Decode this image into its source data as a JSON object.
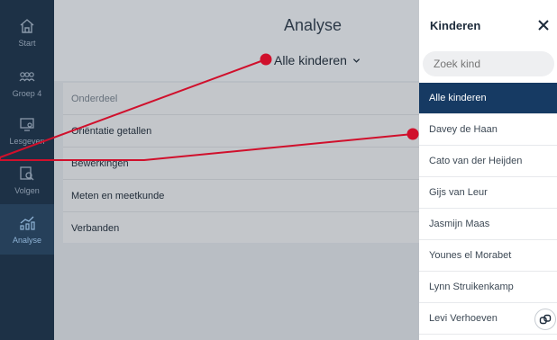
{
  "nav": {
    "items": [
      {
        "label": "Start",
        "icon": "home-icon"
      },
      {
        "label": "Groep 4",
        "icon": "group-icon"
      },
      {
        "label": "Lesgeven",
        "icon": "teach-icon"
      },
      {
        "label": "Volgen",
        "icon": "follow-icon"
      },
      {
        "label": "Analyse",
        "icon": "chart-icon",
        "active": true
      }
    ]
  },
  "header": {
    "title": "Analyse",
    "filter_label": "Alle kinderen"
  },
  "table": {
    "column_header": "Onderdeel",
    "rows": [
      "Oriëntatie getallen",
      "Bewerkingen",
      "Meten en meetkunde",
      "Verbanden"
    ]
  },
  "drawer": {
    "title": "Kinderen",
    "search_placeholder": "Zoek kind",
    "items": [
      "Alle kinderen",
      "Davey de Haan",
      "Cato van der Heijden",
      "Gijs van Leur",
      "Jasmijn Maas",
      "Younes el Morabet",
      "Lynn Struikenkamp",
      "Levi Verhoeven"
    ],
    "selected_index": 0
  },
  "colors": {
    "sidebar": "#1d3146",
    "selected": "#163a63",
    "annotation": "#d0102c"
  }
}
